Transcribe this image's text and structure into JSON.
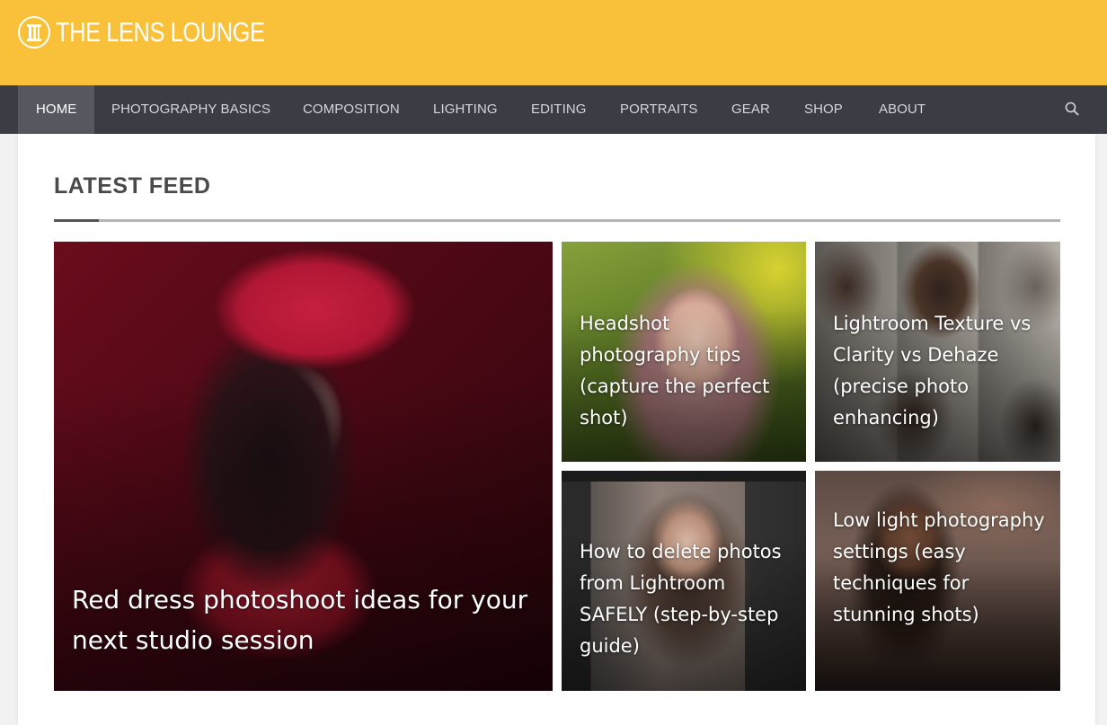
{
  "brand": {
    "name": "THE LENS LOUNGE",
    "icon": "lens-lounge-logo-icon",
    "header_color": "#f9c13a",
    "nav_color": "#3a3d44"
  },
  "nav": {
    "items": [
      {
        "label": "HOME",
        "active": true
      },
      {
        "label": "PHOTOGRAPHY BASICS",
        "active": false
      },
      {
        "label": "COMPOSITION",
        "active": false
      },
      {
        "label": "LIGHTING",
        "active": false
      },
      {
        "label": "EDITING",
        "active": false
      },
      {
        "label": "PORTRAITS",
        "active": false
      },
      {
        "label": "GEAR",
        "active": false
      },
      {
        "label": "SHOP",
        "active": false
      },
      {
        "label": "ABOUT",
        "active": false
      }
    ],
    "search_icon": "search-icon"
  },
  "feed": {
    "title": "LATEST FEED",
    "posts": [
      {
        "title": "Red dress photoshoot ideas for your next studio session"
      },
      {
        "title": "Headshot photography tips (capture the perfect shot)"
      },
      {
        "title": "Lightroom Texture vs Clarity vs Dehaze (precise photo enhancing)"
      },
      {
        "title": "How to delete photos from Lightroom SAFELY (step-by-step guide)"
      },
      {
        "title": "Low light photography settings (easy techniques for stunning shots)"
      }
    ]
  }
}
